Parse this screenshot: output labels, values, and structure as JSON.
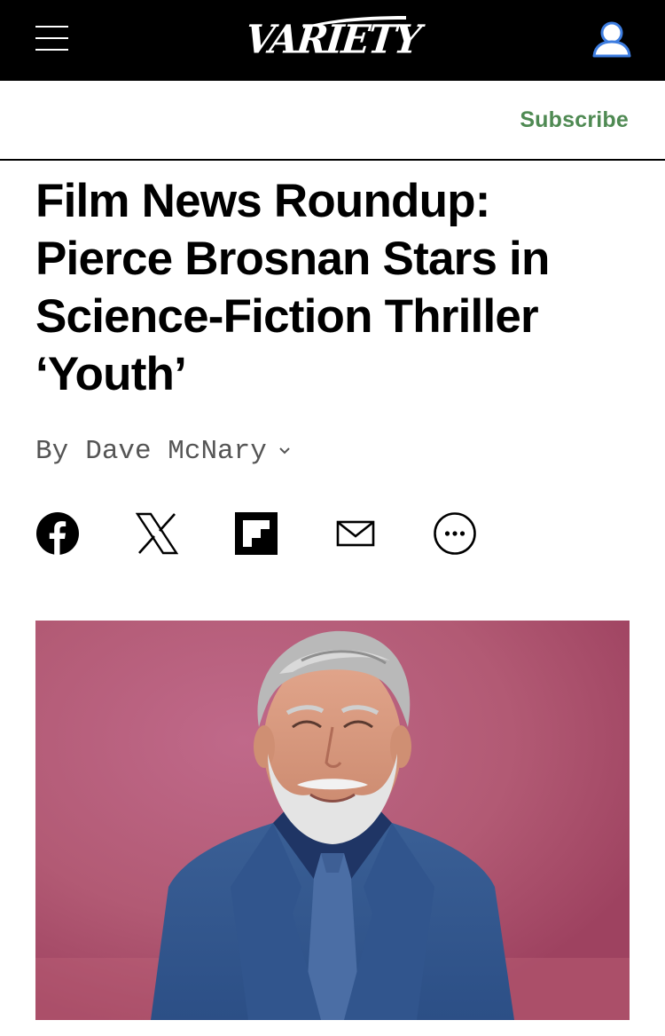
{
  "header": {
    "brand": "VARIETY",
    "menu_icon": "hamburger-icon",
    "account_icon": "user-icon"
  },
  "subheader": {
    "subscribe_label": "Subscribe",
    "subscribe_color": "#4f8a53"
  },
  "article": {
    "headline_lines": [
      "Film News Roundup:",
      "Pierce Brosnan Stars in",
      "Science-Fiction Thriller",
      "‘Youth’"
    ],
    "byline_prefix": "By",
    "author": "Dave McNary"
  },
  "share": {
    "icons": [
      "facebook-icon",
      "x-icon",
      "flipboard-icon",
      "email-icon",
      "more-icon"
    ]
  },
  "hero_image": {
    "icon": "pierce-brosnan-photo",
    "background_color": "#b05a74"
  }
}
